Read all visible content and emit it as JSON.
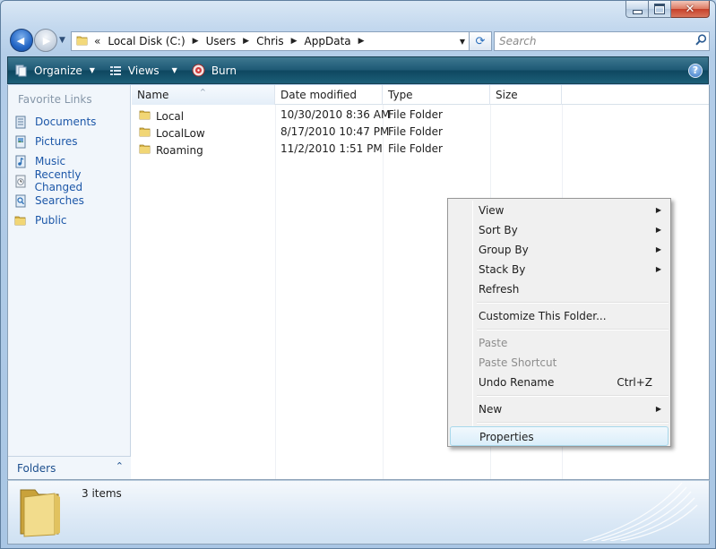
{
  "window": {
    "minimize_label": "Minimize",
    "maximize_label": "Maximize",
    "close_glyph": "✕"
  },
  "navigation": {
    "back_glyph": "◀",
    "forward_glyph": "▶",
    "history_glyph": "▼"
  },
  "address_bar": {
    "overflow": "«",
    "crumbs": [
      "Local Disk (C:)",
      "Users",
      "Chris",
      "AppData"
    ],
    "separator_glyph": "▶",
    "dropdown_glyph": "▼"
  },
  "refresh": {
    "glyph": "⟳"
  },
  "search": {
    "placeholder": "Search",
    "value": "",
    "icon": "search-icon"
  },
  "toolbar": {
    "organize": "Organize",
    "views": "Views",
    "burn": "Burn",
    "dropdown_glyph": "▼",
    "help_glyph": "?"
  },
  "nav_pane": {
    "heading": "Favorite Links",
    "links": [
      {
        "label": "Documents",
        "icon": "documents-icon"
      },
      {
        "label": "Pictures",
        "icon": "pictures-icon"
      },
      {
        "label": "Music",
        "icon": "music-icon"
      },
      {
        "label": "Recently Changed",
        "icon": "recently-changed-icon"
      },
      {
        "label": "Searches",
        "icon": "searches-icon"
      },
      {
        "label": "Public",
        "icon": "public-folder-icon"
      }
    ],
    "folders_label": "Folders",
    "folders_chevron": "⌃"
  },
  "columns": [
    "Name",
    "Date modified",
    "Type",
    "Size"
  ],
  "sort_caret": "^",
  "files": [
    {
      "name": "Local",
      "date": "10/30/2010 8:36 AM",
      "type": "File Folder",
      "size": ""
    },
    {
      "name": "LocalLow",
      "date": "8/17/2010 10:47 PM",
      "type": "File Folder",
      "size": ""
    },
    {
      "name": "Roaming",
      "date": "11/2/2010 1:51 PM",
      "type": "File Folder",
      "size": ""
    }
  ],
  "details": {
    "item_count": "3 items"
  },
  "context_menu": {
    "submenu_glyph": "▶",
    "items": [
      {
        "label": "View",
        "submenu": true
      },
      {
        "label": "Sort By",
        "submenu": true
      },
      {
        "label": "Group By",
        "submenu": true
      },
      {
        "label": "Stack By",
        "submenu": true
      },
      {
        "label": "Refresh"
      },
      {
        "label": "Customize This Folder..."
      },
      {
        "label": "Paste",
        "disabled": true
      },
      {
        "label": "Paste Shortcut",
        "disabled": true
      },
      {
        "label": "Undo Rename",
        "shortcut": "Ctrl+Z"
      },
      {
        "label": "New",
        "submenu": true
      },
      {
        "label": "Properties",
        "highlighted": true
      }
    ]
  },
  "colors": {
    "command_bar": "#1f5a75",
    "link_text": "#1c57a8",
    "menu_highlight": "#daeefa",
    "folder_yellow": "#e9c75a"
  }
}
